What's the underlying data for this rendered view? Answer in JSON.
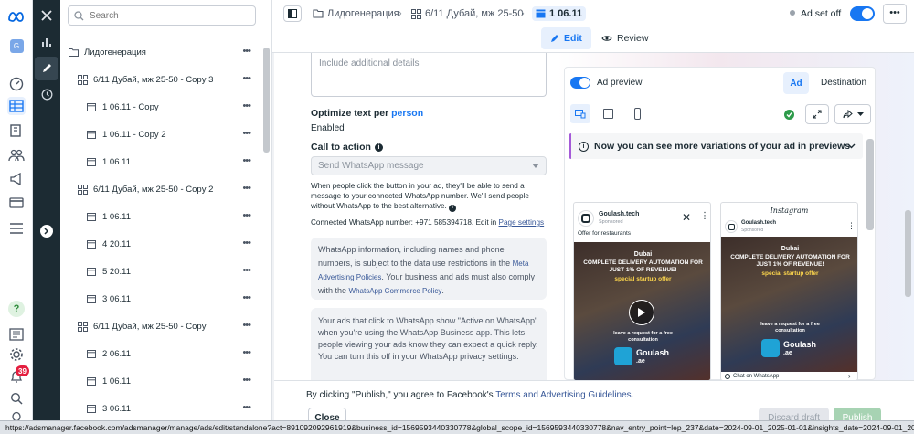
{
  "colors": {
    "accent": "#1877f2",
    "dark_panel": "#1c2b33",
    "link": "#385898"
  },
  "search": {
    "placeholder": "Search"
  },
  "tree": {
    "items": [
      {
        "label": "Лидогенерация",
        "icon": "folder-icon"
      },
      {
        "label": "6/11 Дубай, мж 25-50 - Copy 3",
        "icon": "adset-grid-icon"
      },
      {
        "label": "1 06.11 - Copy",
        "icon": "ad-icon"
      },
      {
        "label": "1 06.11 - Copy 2",
        "icon": "ad-icon"
      },
      {
        "label": "1 06.11",
        "icon": "ad-icon"
      },
      {
        "label": "6/11 Дубай, мж 25-50 - Copy 2",
        "icon": "adset-grid-icon"
      },
      {
        "label": "1 06.11",
        "icon": "ad-icon"
      },
      {
        "label": "4 20.11",
        "icon": "ad-icon"
      },
      {
        "label": "5 20.11",
        "icon": "ad-icon"
      },
      {
        "label": "3 06.11",
        "icon": "ad-icon"
      },
      {
        "label": "6/11 Дубай, мж 25-50 - Copy",
        "icon": "adset-grid-icon"
      },
      {
        "label": "2 06.11",
        "icon": "ad-icon"
      },
      {
        "label": "1 06.11",
        "icon": "ad-icon"
      },
      {
        "label": "3 06.11",
        "icon": "ad-icon"
      }
    ],
    "more": "•••"
  },
  "rail": {
    "notification_badge": "39"
  },
  "breadcrumbs": {
    "campaign": "Лидогенерация",
    "adset": "6/11 Дубай, мж 25-50",
    "ad": "1 06.11"
  },
  "topbar": {
    "adset_status": "Ad set off",
    "edit_tab": "Edit",
    "review_tab": "Review",
    "more": "•••"
  },
  "form": {
    "details_placeholder": "Include additional details",
    "optimize_label_prefix": "Optimize text per ",
    "optimize_label_link": "person",
    "optimize_value": "Enabled",
    "cta_label": "Call to action",
    "cta_value": "Send WhatsApp message",
    "cta_help": "When people click the button in your ad, they'll be able to send a message to your connected WhatsApp number. We'll send people without WhatsApp to the best alternative.",
    "connected_prefix": "Connected WhatsApp number: +971 585394718. Edit in ",
    "connected_link": "Page settings",
    "info1_text": "WhatsApp information, including names and phone numbers, is subject to the data use restrictions in the ",
    "info1_link1": "Meta Advertising Policies",
    "info1_mid": ". Your business and ads must also comply with the ",
    "info1_link2": "WhatsApp Commerce Policy",
    "info1_end": ".",
    "info2_text": "Your ads that click to WhatsApp show \"Active on WhatsApp\" when you're using the WhatsApp Business app. This lets people viewing your ads know they can expect a quick reply. You can turn this off in your WhatsApp privacy settings."
  },
  "preview": {
    "toggle_label": "Ad preview",
    "tab_ad": "Ad",
    "tab_destination": "Destination",
    "banner": "Now you can see more variations of your ad in previews",
    "fb_card": {
      "page": "Goulash.tech",
      "sponsored": "Sponsored",
      "primary_text": "Offer for restaurants"
    },
    "ig_card": {
      "header": "Instagram",
      "page": "Goulash.tech",
      "sponsored": "Sponsored",
      "cta": "Chat on WhatsApp"
    },
    "creative": {
      "city": "Dubai",
      "headline": "COMPLETE DELIVERY AUTOMATION FOR JUST 1% OF REVENUE!",
      "offer": "special startup offer",
      "request": "leave a request for a free consultation",
      "brand": "Goulash",
      "brand_sub": ".ae"
    }
  },
  "footer": {
    "consent_prefix": "By clicking \"Publish,\" you agree to Facebook's ",
    "consent_link": "Terms and Advertising Guidelines",
    "consent_end": ".",
    "close": "Close",
    "discard": "Discard draft",
    "publish": "Publish"
  },
  "status_url": "https://adsmanager.facebook.com/adsmanager/manage/ads/edit/standalone?act=891092092961919&business_id=1569593440330778&global_scope_id=1569593440330778&nav_entry_point=lep_237&date=2024-09-01_2025-01-01&insights_date=2024-09-01_2025-01-01&insights_date_selec..."
}
